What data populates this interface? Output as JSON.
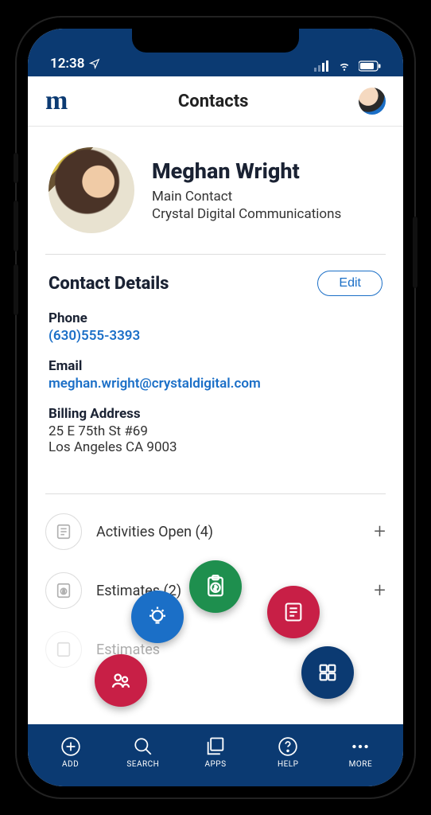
{
  "status": {
    "time": "12:38"
  },
  "header": {
    "title": "Contacts"
  },
  "contact": {
    "name": "Meghan Wright",
    "role": "Main Contact",
    "company": "Crystal Digital Communications"
  },
  "details": {
    "section_title": "Contact Details",
    "edit_label": "Edit",
    "phone_label": "Phone",
    "phone_value": "(630)555-3393",
    "email_label": "Email",
    "email_value": "meghan.wright@crystaldigital.com",
    "billing_label": "Billing Address",
    "billing_line1": "25 E 75th St #69",
    "billing_line2": "Los Angeles CA 9003"
  },
  "rows": {
    "activities_label": "Activities Open (4)",
    "estimates_label": "Estimates (2)",
    "third_label": "Estimates"
  },
  "nav": {
    "add": "ADD",
    "search": "SEARCH",
    "apps": "APPS",
    "help": "HELP",
    "more": "MORE"
  }
}
